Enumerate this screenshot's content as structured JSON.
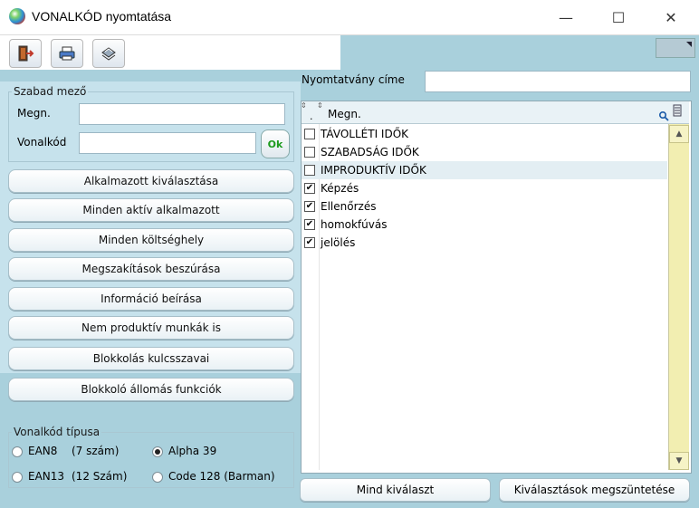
{
  "window": {
    "title": "VONALKÓD nyomtatása",
    "minimize": "—",
    "maximize": "☐",
    "close": "✕"
  },
  "form": {
    "title_label": "Nyomtatvány címe",
    "title_value": ""
  },
  "free_field": {
    "legend": "Szabad mező",
    "name_label": "Megn.",
    "name_value": "",
    "barcode_label": "Vonalkód",
    "barcode_value": "",
    "ok_label": "Ok"
  },
  "actions": [
    "Alkalmazott kiválasztása",
    "Minden aktív alkalmazott",
    "Minden költséghely",
    "Megszakítások beszúrása",
    "Információ beírása",
    "Nem produktív munkák is",
    "Blokkolás kulcsszavai",
    "Blokkoló állomás funkciók"
  ],
  "barcode_type": {
    "legend": "Vonalkód típusa",
    "options": [
      {
        "label": "EAN8",
        "note": "(7 szám)",
        "selected": false
      },
      {
        "label": "Alpha 39",
        "note": "",
        "selected": true
      },
      {
        "label": "EAN13",
        "note": "(12 Szám)",
        "selected": false
      },
      {
        "label": "Code 128 (Barman)",
        "note": "",
        "selected": false
      }
    ]
  },
  "grid": {
    "header_dot": ".",
    "header": "Megn.",
    "rows": [
      {
        "label": "TÁVOLLÉTI IDŐK",
        "checked": false
      },
      {
        "label": "SZABADSÁG IDŐK",
        "checked": false
      },
      {
        "label": "IMPRODUKTÍV IDŐK",
        "checked": false
      },
      {
        "label": "Képzés",
        "checked": true
      },
      {
        "label": "Ellenőrzés",
        "checked": true
      },
      {
        "label": "homokfúvás",
        "checked": true
      },
      {
        "label": "jelölés",
        "checked": true
      }
    ]
  },
  "bottom_buttons": {
    "select_all": "Mind kiválaszt",
    "clear_selection": "Kiválasztások megszüntetése"
  }
}
